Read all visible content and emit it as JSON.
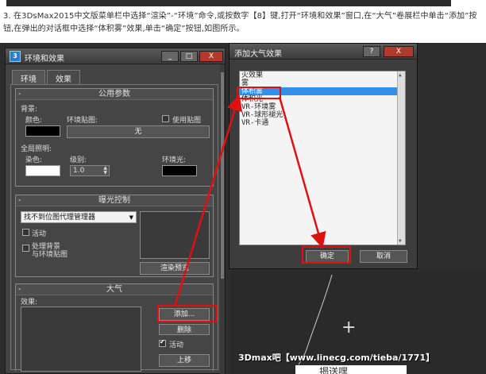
{
  "caption": "3. 在3DsMax2015中文版菜单栏中选择“渲染”-“环境”命令,或按数字【8】键,打开“环境和效果”窗口,在“大气”卷展栏中单击“添加”按钮,在弹出的对话框中选择“体积雾”效果,单击“确定”按钮,如图所示。",
  "env_window": {
    "title": "环境和效果",
    "title_buttons": [
      "_",
      "□",
      "X"
    ],
    "tabs": [
      {
        "label": "环境"
      },
      {
        "label": "效果"
      }
    ],
    "common": {
      "header": "公用参数",
      "minus": "-",
      "background_label": "背景:",
      "color_label": "颜色:",
      "env_map_label": "环境贴图:",
      "use_map_label": "使用贴图",
      "none_button": "无",
      "global_lighting_label": "全局照明:",
      "tint_label": "染色:",
      "level_label": "级别:",
      "level_value": "1.0",
      "ambient_label": "环境光:"
    },
    "exposure": {
      "header": "曝光控制",
      "minus": "-",
      "dropdown": "找不到位图代理管理器",
      "active_label": "活动",
      "process_bg_label_1": "处理背景",
      "process_bg_label_2": "与环境贴图",
      "render_preview": "渲染预览"
    },
    "atmosphere": {
      "header": "大气",
      "minus": "-",
      "effects_label": "效果:",
      "add_button": "添加...",
      "delete_button": "删除",
      "active_label": "活动",
      "move_up_button": "上移"
    }
  },
  "add_dialog": {
    "title": "添加大气效果",
    "title_buttons": [
      "?",
      "X"
    ],
    "effects": [
      {
        "label": "火效果",
        "selected": false
      },
      {
        "label": "雾",
        "selected": false
      },
      {
        "label": "体积雾",
        "selected": true
      },
      {
        "label": "体积光",
        "selected": false
      },
      {
        "label": "VR-环境雾",
        "selected": false
      },
      {
        "label": "VR-球形褪光",
        "selected": false
      },
      {
        "label": "VR-卡通",
        "selected": false
      }
    ],
    "ok_button": "确定",
    "cancel_button": "取消"
  },
  "watermark": "3Dmax吧【www.linecg.com/tieba/1771】",
  "bottom_text": "揭送嘿",
  "colors": {
    "highlight": "#e01010",
    "selection": "#3390ea",
    "arrow": "#e01010"
  }
}
